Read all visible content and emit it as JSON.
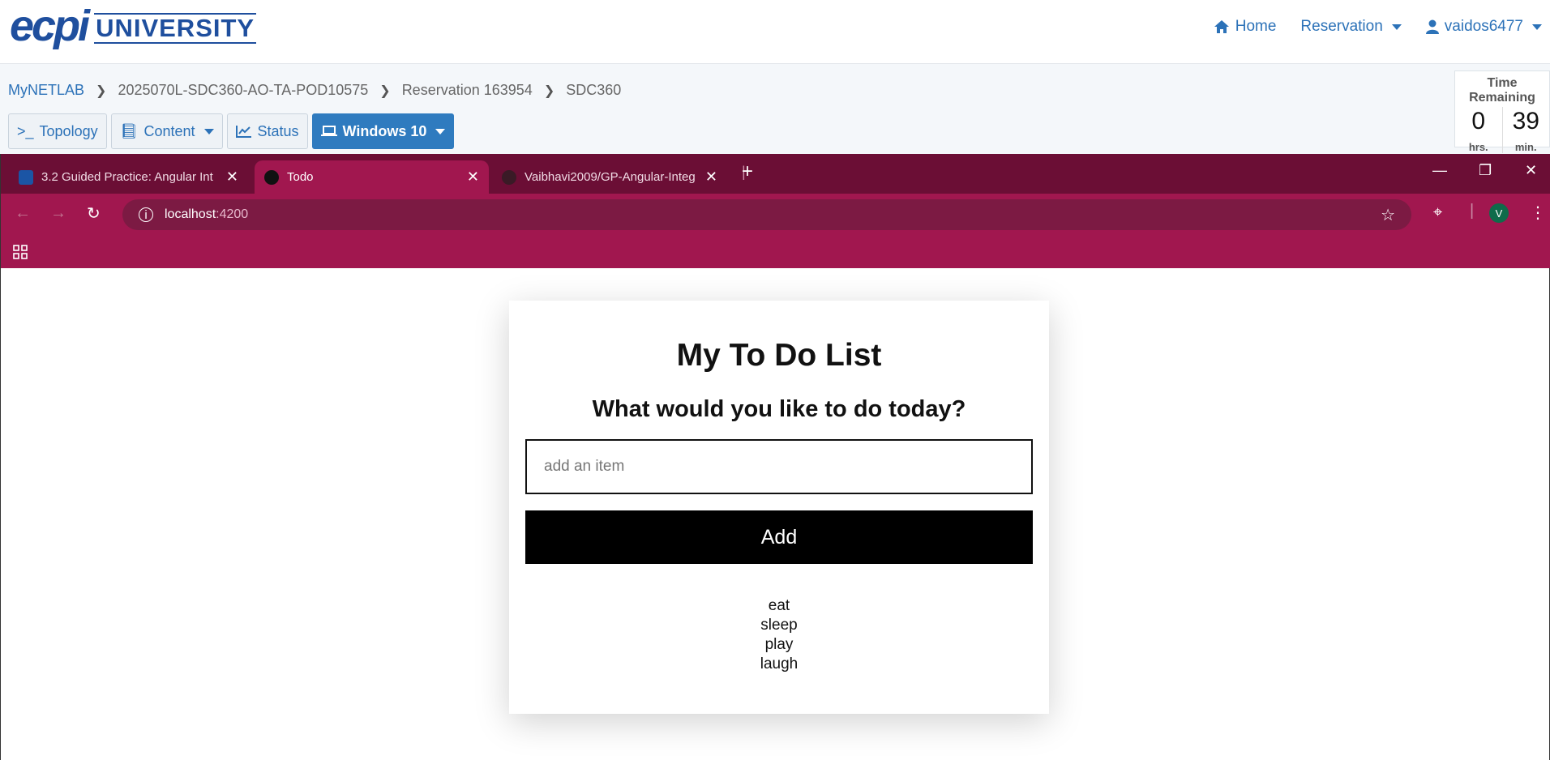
{
  "top_nav": {
    "logo_mark": "ecpi",
    "logo_text": "UNIVERSITY",
    "home": "Home",
    "reservation": "Reservation",
    "user": "vaidos6477"
  },
  "breadcrumb": [
    "MyNETLAB",
    "2025070L-SDC360-AO-TA-POD10575",
    "Reservation 163954",
    "SDC360"
  ],
  "lab_tabs": {
    "topology": "Topology",
    "content": "Content",
    "status": "Status",
    "windows": "Windows 10"
  },
  "time_remaining": {
    "label": "Time Remaining",
    "hours": "0",
    "hours_unit": "hrs.",
    "minutes": "39",
    "minutes_unit": "min."
  },
  "browser": {
    "tabs": [
      {
        "title": "3.2 Guided Practice: Angular Int"
      },
      {
        "title": "Todo"
      },
      {
        "title": "Vaibhavi2009/GP-Angular-Integ"
      }
    ],
    "address": {
      "host": "localhost",
      "port": ":4200"
    },
    "profile_initial": "V",
    "theme_color": "#a1174f"
  },
  "app": {
    "title": "My To Do List",
    "prompt": "What would you like to do today?",
    "input_placeholder": "add an item",
    "add_label": "Add",
    "items": [
      "eat",
      "sleep",
      "play",
      "laugh"
    ]
  }
}
